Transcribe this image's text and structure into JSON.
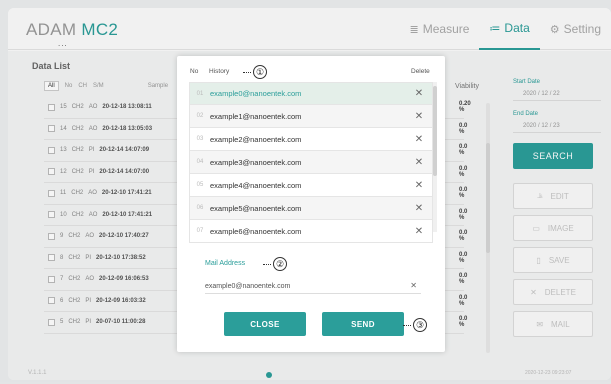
{
  "app": {
    "logo_prefix": "ADAM",
    "logo_suffix": "MC2",
    "logo_dots": "..."
  },
  "tabs": [
    {
      "label": "Measure",
      "icon": "measure-icon",
      "glyph": "≣"
    },
    {
      "label": "Data",
      "icon": "data-list-icon",
      "glyph": "≔"
    },
    {
      "label": "Setting",
      "icon": "gear-icon",
      "glyph": "⚙"
    }
  ],
  "data_list": {
    "title": "Data List",
    "filters": [
      "All",
      "No",
      "CH",
      "S/M",
      "Sample"
    ],
    "viability_header": "Viability",
    "rows": [
      {
        "no": "15",
        "ch": "CH2",
        "sm": "AO",
        "date": "20-12-18 13:08:11",
        "viability": "0.20 %"
      },
      {
        "no": "14",
        "ch": "CH2",
        "sm": "AO",
        "date": "20-12-18 13:05:03",
        "viability": "0.0 %"
      },
      {
        "no": "13",
        "ch": "CH2",
        "sm": "PI",
        "date": "20-12-14 14:07:09",
        "viability": "0.0 %"
      },
      {
        "no": "12",
        "ch": "CH2",
        "sm": "PI",
        "date": "20-12-14 14:07:00",
        "viability": "0.0 %"
      },
      {
        "no": "11",
        "ch": "CH2",
        "sm": "AO",
        "date": "20-12-10 17:41:21",
        "viability": "0.0 %"
      },
      {
        "no": "10",
        "ch": "CH2",
        "sm": "AO",
        "date": "20-12-10 17:41:21",
        "viability": "0.0 %"
      },
      {
        "no": "9",
        "ch": "CH2",
        "sm": "AO",
        "date": "20-12-10 17:40:27",
        "viability": "0.0 %"
      },
      {
        "no": "8",
        "ch": "CH2",
        "sm": "PI",
        "date": "20-12-10 17:38:52",
        "viability": "0.0 %"
      },
      {
        "no": "7",
        "ch": "CH2",
        "sm": "AO",
        "date": "20-12-09 16:06:53",
        "viability": "0.0 %"
      },
      {
        "no": "6",
        "ch": "CH2",
        "sm": "PI",
        "date": "20-12-09 16:03:32",
        "viability": "0.0 %"
      },
      {
        "no": "5",
        "ch": "CH2",
        "sm": "PI",
        "date": "20-07-10 11:00:28",
        "viability": "0.0 %"
      }
    ]
  },
  "side": {
    "start_label": "Start Date",
    "start_value": "2020 / 12 / 22",
    "end_label": "End Date",
    "end_value": "2020 / 12 / 23",
    "search": "SEARCH",
    "buttons": [
      {
        "label": "EDIT",
        "icon": "chart-edit-icon",
        "glyph": "⫡"
      },
      {
        "label": "IMAGE",
        "icon": "image-icon",
        "glyph": "▭"
      },
      {
        "label": "SAVE",
        "icon": "usb-save-icon",
        "glyph": "▯"
      },
      {
        "label": "DELETE",
        "icon": "delete-x-icon",
        "glyph": "✕"
      },
      {
        "label": "MAIL",
        "icon": "mail-icon",
        "glyph": "✉"
      }
    ]
  },
  "footer": {
    "version": "V.1.1.1",
    "datetime": "2020-12-23 09:23:07"
  },
  "dialog": {
    "col_no": "No",
    "col_history": "History",
    "col_delete": "Delete",
    "history": [
      {
        "idx": "01",
        "email": "example0@nanoentek.com"
      },
      {
        "idx": "02",
        "email": "example1@nanoentek.com"
      },
      {
        "idx": "03",
        "email": "example2@nanoentek.com"
      },
      {
        "idx": "04",
        "email": "example3@nanoentek.com"
      },
      {
        "idx": "05",
        "email": "example4@nanoentek.com"
      },
      {
        "idx": "06",
        "email": "example5@nanoentek.com"
      },
      {
        "idx": "07",
        "email": "example6@nanoentek.com"
      }
    ],
    "delete_glyph": "✕",
    "mail_label": "Mail Address",
    "mail_value": "example0@nanoentek.com",
    "clear_glyph": "✕",
    "close": "CLOSE",
    "send": "SEND"
  },
  "callouts": [
    "①",
    "②",
    "③"
  ]
}
